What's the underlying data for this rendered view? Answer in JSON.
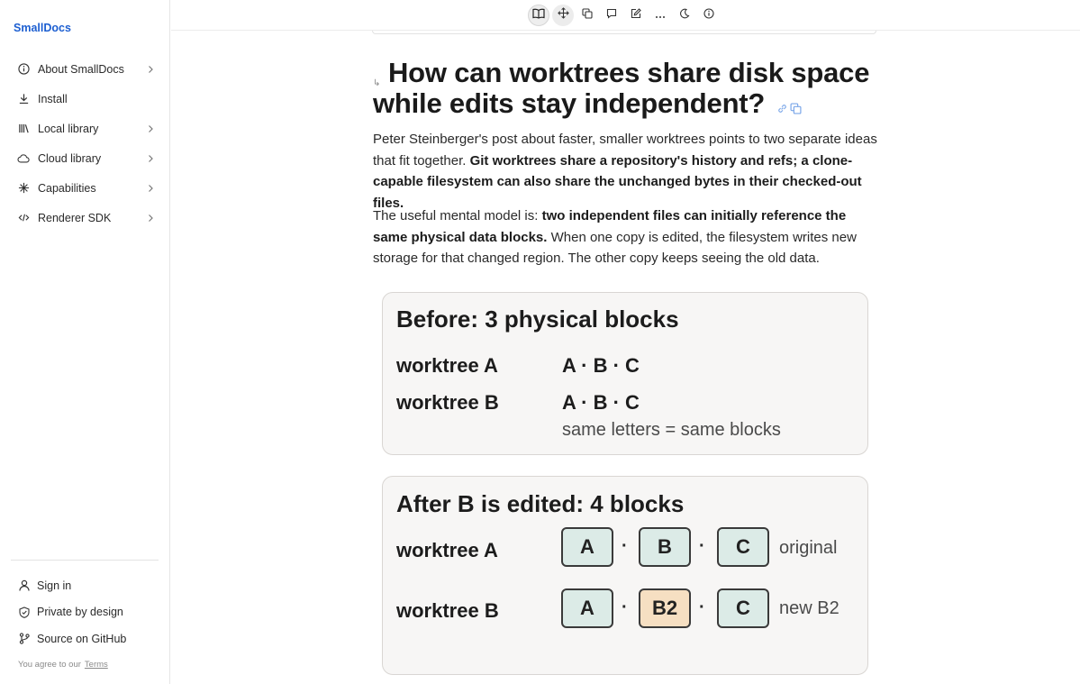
{
  "sidebar": {
    "brand": "SmallDocs",
    "items": [
      {
        "label": "About SmallDocs",
        "icon": "info-icon",
        "has_chevron": true
      },
      {
        "label": "Install",
        "icon": "download-icon",
        "has_chevron": false
      },
      {
        "label": "Local library",
        "icon": "library-icon",
        "has_chevron": true
      },
      {
        "label": "Cloud library",
        "icon": "cloud-icon",
        "has_chevron": true
      },
      {
        "label": "Capabilities",
        "icon": "sparkle-icon",
        "has_chevron": true
      },
      {
        "label": "Renderer SDK",
        "icon": "code-icon",
        "has_chevron": true
      }
    ],
    "footer": [
      {
        "label": "Sign in",
        "icon": "user-icon"
      },
      {
        "label": "Private by design",
        "icon": "shield-icon"
      },
      {
        "label": "Source on GitHub",
        "icon": "git-branch-icon"
      }
    ],
    "terms_prefix": "You agree to our",
    "terms_link": "Terms"
  },
  "toolbar": {
    "tools": [
      "book-icon",
      "move-icon",
      "copy-icon",
      "comment-icon",
      "edit-icon",
      "more-icon",
      "moon-icon",
      "info-icon"
    ],
    "active": "book-icon",
    "hovered": "move-icon"
  },
  "doc": {
    "anchor_glyph": "↳",
    "heading": "How can worktrees share disk space while edits stay independent?",
    "p1": {
      "plain": "Peter Steinberger's post about faster, smaller worktrees points to two separate ideas that fit together. ",
      "bold": "Git worktrees share a repository's history and refs; a clone-capable filesystem can also share the unchanged bytes in their checked-out files."
    },
    "p2": {
      "plain_a": "The useful mental model is: ",
      "bold": "two independent files can initially reference the same physical data blocks.",
      "plain_b": " When one copy is edited, the filesystem writes new storage for that changed region. The other copy keeps seeing the old data."
    },
    "before": {
      "title": "Before: 3 physical blocks",
      "row_a_label": "worktree A",
      "row_a_value": "A · B · C",
      "row_b_label": "worktree B",
      "row_b_value": "A · B · C",
      "note": "same letters = same blocks"
    },
    "after": {
      "title": "After B is edited: 4 blocks",
      "row_a_label": "worktree A",
      "row_a_blocks": [
        "A",
        "B",
        "C"
      ],
      "row_a_tag": "original",
      "row_b_label": "worktree B",
      "row_b_blocks": [
        "A",
        "B2",
        "C"
      ],
      "row_b_tag": "new B2",
      "separator": "·"
    }
  },
  "colors": {
    "brand": "#1d5fd1",
    "block_original": "#dcebe7",
    "block_new": "#f6dfc2",
    "card_bg": "#f7f6f5"
  }
}
